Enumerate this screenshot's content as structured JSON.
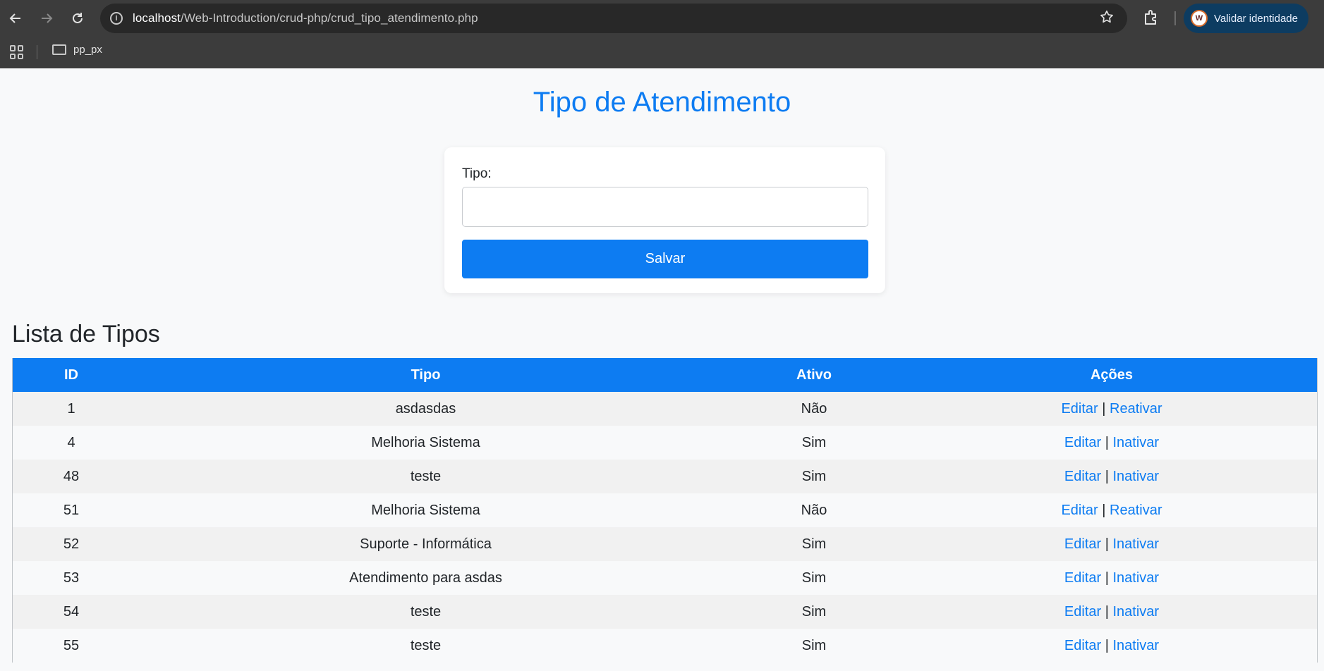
{
  "browser": {
    "url_host": "localhost",
    "url_path": "/Web-Introduction/crud-php/crud_tipo_atendimento.php",
    "profile_label": "Validar identidade",
    "profile_initial": "W",
    "bookmark_folder": "pp_px"
  },
  "page": {
    "title": "Tipo de Atendimento",
    "form": {
      "label": "Tipo:",
      "input_value": "",
      "save_label": "Salvar"
    },
    "list_title": "Lista de Tipos",
    "table": {
      "headers": [
        "ID",
        "Tipo",
        "Ativo",
        "Ações"
      ],
      "rows": [
        {
          "id": "1",
          "tipo": "asdasdas",
          "ativo": "Não",
          "edit": "Editar",
          "sep": "|",
          "toggle": "Reativar"
        },
        {
          "id": "4",
          "tipo": "Melhoria Sistema",
          "ativo": "Sim",
          "edit": "Editar",
          "sep": "|",
          "toggle": "Inativar"
        },
        {
          "id": "48",
          "tipo": "teste",
          "ativo": "Sim",
          "edit": "Editar",
          "sep": "|",
          "toggle": "Inativar"
        },
        {
          "id": "51",
          "tipo": "Melhoria Sistema",
          "ativo": "Não",
          "edit": "Editar",
          "sep": "|",
          "toggle": "Reativar"
        },
        {
          "id": "52",
          "tipo": "Suporte - Informática",
          "ativo": "Sim",
          "edit": "Editar",
          "sep": "|",
          "toggle": "Inativar"
        },
        {
          "id": "53",
          "tipo": "Atendimento para asdas",
          "ativo": "Sim",
          "edit": "Editar",
          "sep": "|",
          "toggle": "Inativar"
        },
        {
          "id": "54",
          "tipo": "teste",
          "ativo": "Sim",
          "edit": "Editar",
          "sep": "|",
          "toggle": "Inativar"
        },
        {
          "id": "55",
          "tipo": "teste",
          "ativo": "Sim",
          "edit": "Editar",
          "sep": "|",
          "toggle": "Inativar"
        }
      ]
    }
  },
  "colors": {
    "accent": "#0d7cf2",
    "chrome_bg": "#3c3c3c",
    "page_bg": "#f8f9fa"
  }
}
